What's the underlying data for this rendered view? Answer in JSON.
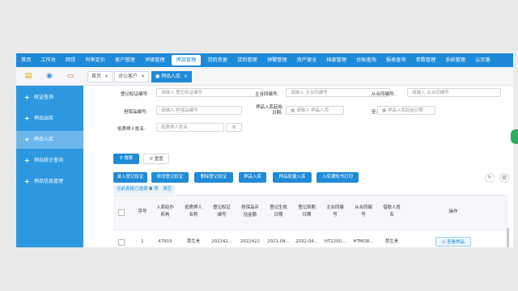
{
  "nav": {
    "items": [
      "首页",
      "工作台",
      "网贷",
      "利率定价",
      "客户管理",
      "评级管理",
      "押品管理",
      "贷后变更",
      "贷后管理",
      "预警管理",
      "资产保全",
      "档案管理",
      "台账查询",
      "报表查询",
      "参数管理",
      "系统管理",
      "公示落"
    ],
    "active_index": 6
  },
  "tabbar": {
    "icons": [
      "file-icon",
      "user-icon",
      "card-icon"
    ],
    "tabs": [
      {
        "label": "首页",
        "close": "×"
      },
      {
        "label": "对公客户",
        "close": "×"
      },
      {
        "label": "押品入库",
        "close": "×",
        "active": true
      }
    ]
  },
  "sidebar": {
    "items": [
      {
        "label": "权证查询",
        "plus": "+"
      },
      {
        "label": "押品出库",
        "plus": "+"
      },
      {
        "label": "押品入库",
        "plus": "+",
        "active": true
      },
      {
        "label": "押品统计查询",
        "plus": "+"
      },
      {
        "label": "押品信息管理",
        "plus": "+"
      }
    ]
  },
  "form": {
    "warrant_no": {
      "label": "登记权证编号:",
      "placeholder": "请输入 登记权证编号"
    },
    "main_contract": {
      "label": "主合同编号:",
      "placeholder": "请输入 主合同编号"
    },
    "sub_contract": {
      "label": "从合同编号:",
      "placeholder": "请输入 从合同编号"
    },
    "collateral_no": {
      "label": "担保品编号:",
      "placeholder": "请输入 担保品编号"
    },
    "storage_date": {
      "label": "押品入库起始日期:",
      "placeholder": "请输入 押品入库"
    },
    "to_date": {
      "label": "至:",
      "placeholder": "押品入库起始日期"
    },
    "mortgagor": {
      "label": "抵质押人姓名:",
      "placeholder": "抵质押人姓名"
    }
  },
  "buttons": {
    "search": "搜索",
    "reset": "重置"
  },
  "actions": [
    "录入登记权证",
    "修改登记权证",
    "删除登记权证",
    "押品入库",
    "押品批量入库",
    "入库通知书打印"
  ],
  "selection": {
    "text": "当前表格已选择",
    "count": "0",
    "unit": "项",
    "clear": "清空"
  },
  "table": {
    "headers": [
      "序号",
      "入库经办机构",
      "抵质押人名称",
      "登记权证编号",
      "担保品评估金额",
      "登记生效日期",
      "登记到期日期",
      "主合同编号",
      "从合同编号",
      "借款人姓名",
      "操作"
    ],
    "rows": [
      {
        "cells": [
          "1",
          "47919",
          "黄生贵",
          "202242...",
          "2022422",
          "2021-04...",
          "2032-04...",
          "HT2200...",
          "HTMOR...",
          "黄生贵"
        ],
        "action": "查看押品"
      }
    ]
  }
}
